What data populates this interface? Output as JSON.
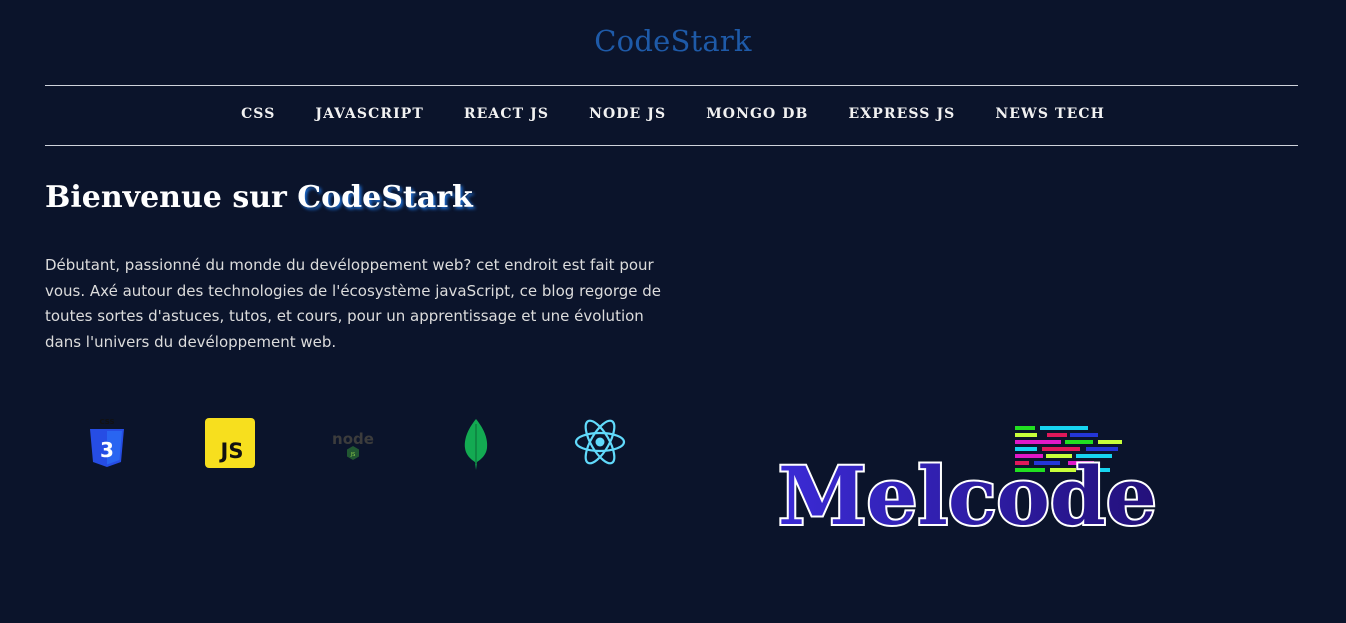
{
  "header": {
    "title": "CodeStark"
  },
  "nav": {
    "items": [
      {
        "label": "CSS"
      },
      {
        "label": "JAVASCRIPT"
      },
      {
        "label": "REACT JS"
      },
      {
        "label": "NODE JS"
      },
      {
        "label": "MONGO DB"
      },
      {
        "label": "EXPRESS JS"
      },
      {
        "label": "NEWS TECH"
      }
    ]
  },
  "hero": {
    "title_prefix": "Bienvenue sur ",
    "title_brand": "CodeStark",
    "intro": "Débutant, passionné du monde du devéloppement web? cet endroit est fait pour vous. Axé autour des technologies de l'écosystème javaScript, ce blog regorge de toutes sortes d'astuces, tutos, et cours, pour un apprentissage et une évolution dans l'univers du devéloppement web."
  },
  "tech_icons": [
    {
      "icon": "css3-icon",
      "badge": "CSS",
      "number": "3"
    },
    {
      "icon": "javascript-icon",
      "label": "JS"
    },
    {
      "icon": "nodejs-icon",
      "label": "node",
      "badge": "JS"
    },
    {
      "icon": "mongodb-leaf-icon"
    },
    {
      "icon": "react-atom-icon"
    }
  ],
  "logo": {
    "text": "Melcode"
  },
  "colors": {
    "background": "#0b142b",
    "title_blue": "#1e5aa8",
    "brand_glow": "#1e6dd0",
    "css_blue": "#264de4",
    "js_yellow": "#f7df1e",
    "mongo_green": "#13aa52",
    "react_cyan": "#61dafb",
    "logo_purple": "#3320b0"
  }
}
